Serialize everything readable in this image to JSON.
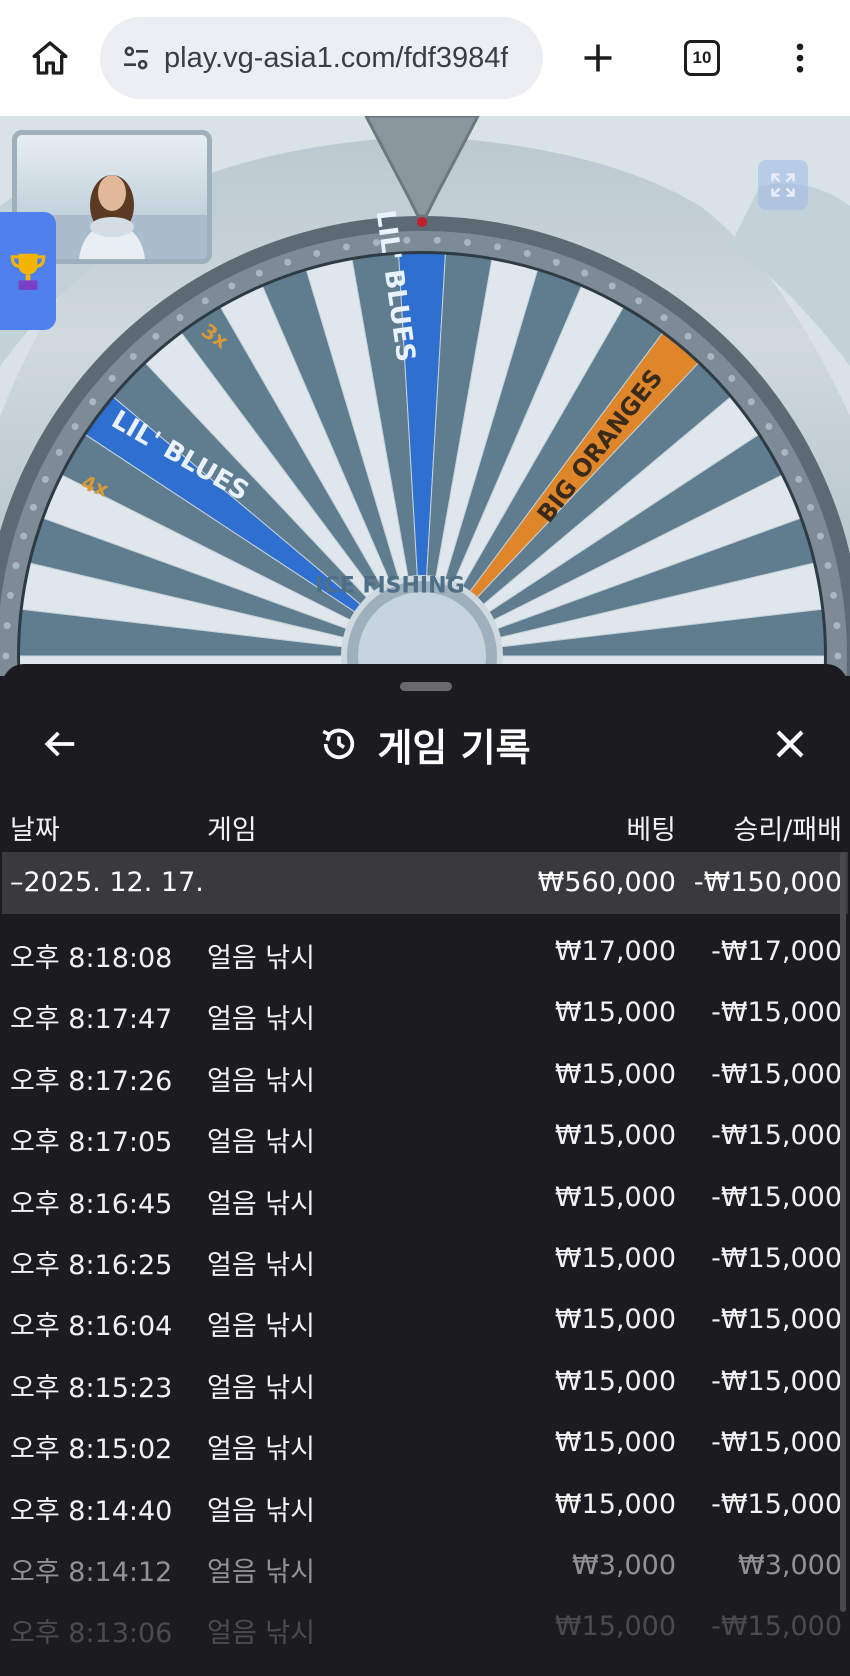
{
  "browser": {
    "url": "play.vg-asia1.com/fdf3984f",
    "tab_count": "10",
    "icons": {
      "home": "home-icon",
      "site_info": "tune-icon",
      "new_tab": "plus-icon",
      "tabs": "tab-switcher-icon",
      "menu": "more-vert-icon"
    }
  },
  "game": {
    "wheel_labels": [
      "LIL' BLUES",
      "LIL' BLUES",
      "BIG ORANGES",
      "3x",
      "4x",
      "ICE FISHING"
    ],
    "icons": {
      "trophy": "trophy-icon",
      "expand": "expand-icon"
    }
  },
  "history": {
    "title": "게임 기록",
    "icons": {
      "back": "arrow-left-icon",
      "history": "history-icon",
      "close": "close-icon"
    },
    "columns": {
      "date": "날짜",
      "game": "게임",
      "bet": "베팅",
      "result": "승리/패배"
    },
    "summary": {
      "date": "–2025. 12. 17.",
      "bet": "₩560,000",
      "result": "-₩150,000"
    },
    "rows": [
      {
        "time": "오후 8:18:08",
        "game": "얼음 낚시",
        "bet": "₩17,000",
        "result": "-₩17,000"
      },
      {
        "time": "오후 8:17:47",
        "game": "얼음 낚시",
        "bet": "₩15,000",
        "result": "-₩15,000"
      },
      {
        "time": "오후 8:17:26",
        "game": "얼음 낚시",
        "bet": "₩15,000",
        "result": "-₩15,000"
      },
      {
        "time": "오후 8:17:05",
        "game": "얼음 낚시",
        "bet": "₩15,000",
        "result": "-₩15,000"
      },
      {
        "time": "오후 8:16:45",
        "game": "얼음 낚시",
        "bet": "₩15,000",
        "result": "-₩15,000"
      },
      {
        "time": "오후 8:16:25",
        "game": "얼음 낚시",
        "bet": "₩15,000",
        "result": "-₩15,000"
      },
      {
        "time": "오후 8:16:04",
        "game": "얼음 낚시",
        "bet": "₩15,000",
        "result": "-₩15,000"
      },
      {
        "time": "오후 8:15:23",
        "game": "얼음 낚시",
        "bet": "₩15,000",
        "result": "-₩15,000"
      },
      {
        "time": "오후 8:15:02",
        "game": "얼음 낚시",
        "bet": "₩15,000",
        "result": "-₩15,000"
      },
      {
        "time": "오후 8:14:40",
        "game": "얼음 낚시",
        "bet": "₩15,000",
        "result": "-₩15,000"
      },
      {
        "time": "오후 8:14:12",
        "game": "얼음 낚시",
        "bet": "₩3,000",
        "result": "₩3,000"
      },
      {
        "time": "오후 8:13:06",
        "game": "얼음 낚시",
        "bet": "₩15,000",
        "result": "-₩15,000"
      }
    ]
  }
}
